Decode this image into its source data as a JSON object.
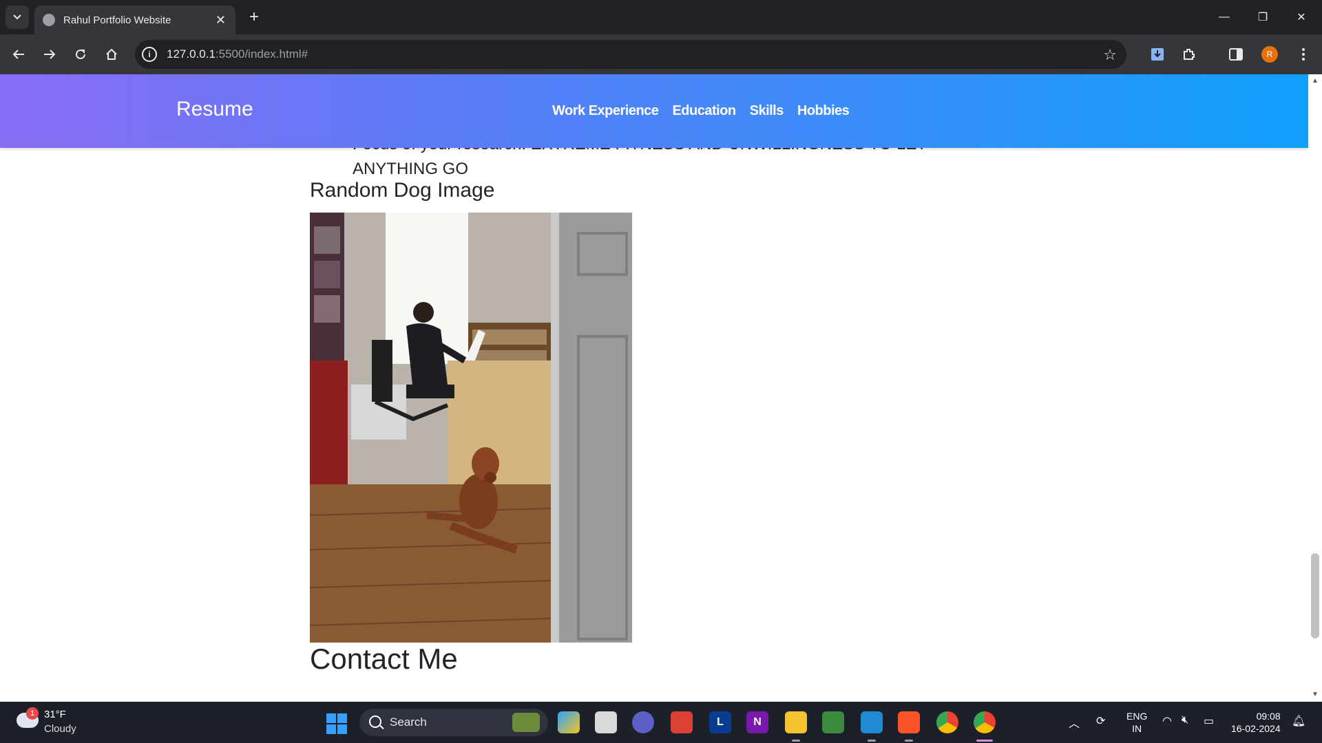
{
  "browser": {
    "tab_title": "Rahul Portfolio Website",
    "url_host": "127.0.0.1",
    "url_rest": ":5500/index.html#",
    "profile_initial": "R"
  },
  "navbar": {
    "brand": "Resume",
    "links": [
      "Work Experience",
      "Education",
      "Skills",
      "Hobbies"
    ]
  },
  "page": {
    "prev_text_line1": "Focus of your research: EXTREME FITNESS AND UNWILLINGNESS TO LET",
    "prev_text_line2": "ANYTHING GO",
    "dog_heading": "Random Dog Image",
    "contact_heading": "Contact Me"
  },
  "taskbar": {
    "weather_badge": "1",
    "temperature": "31°F",
    "condition": "Cloudy",
    "search_label": "Search",
    "lang_line1": "ENG",
    "lang_line2": "IN",
    "time": "09:08",
    "date": "16-02-2024"
  },
  "colors": {
    "navbar_start": "#8a6df5",
    "navbar_end": "#0fa0fb",
    "chrome_dark": "#202124",
    "chrome_toolbar": "#35363a",
    "taskbar_bg": "#1c2029"
  }
}
